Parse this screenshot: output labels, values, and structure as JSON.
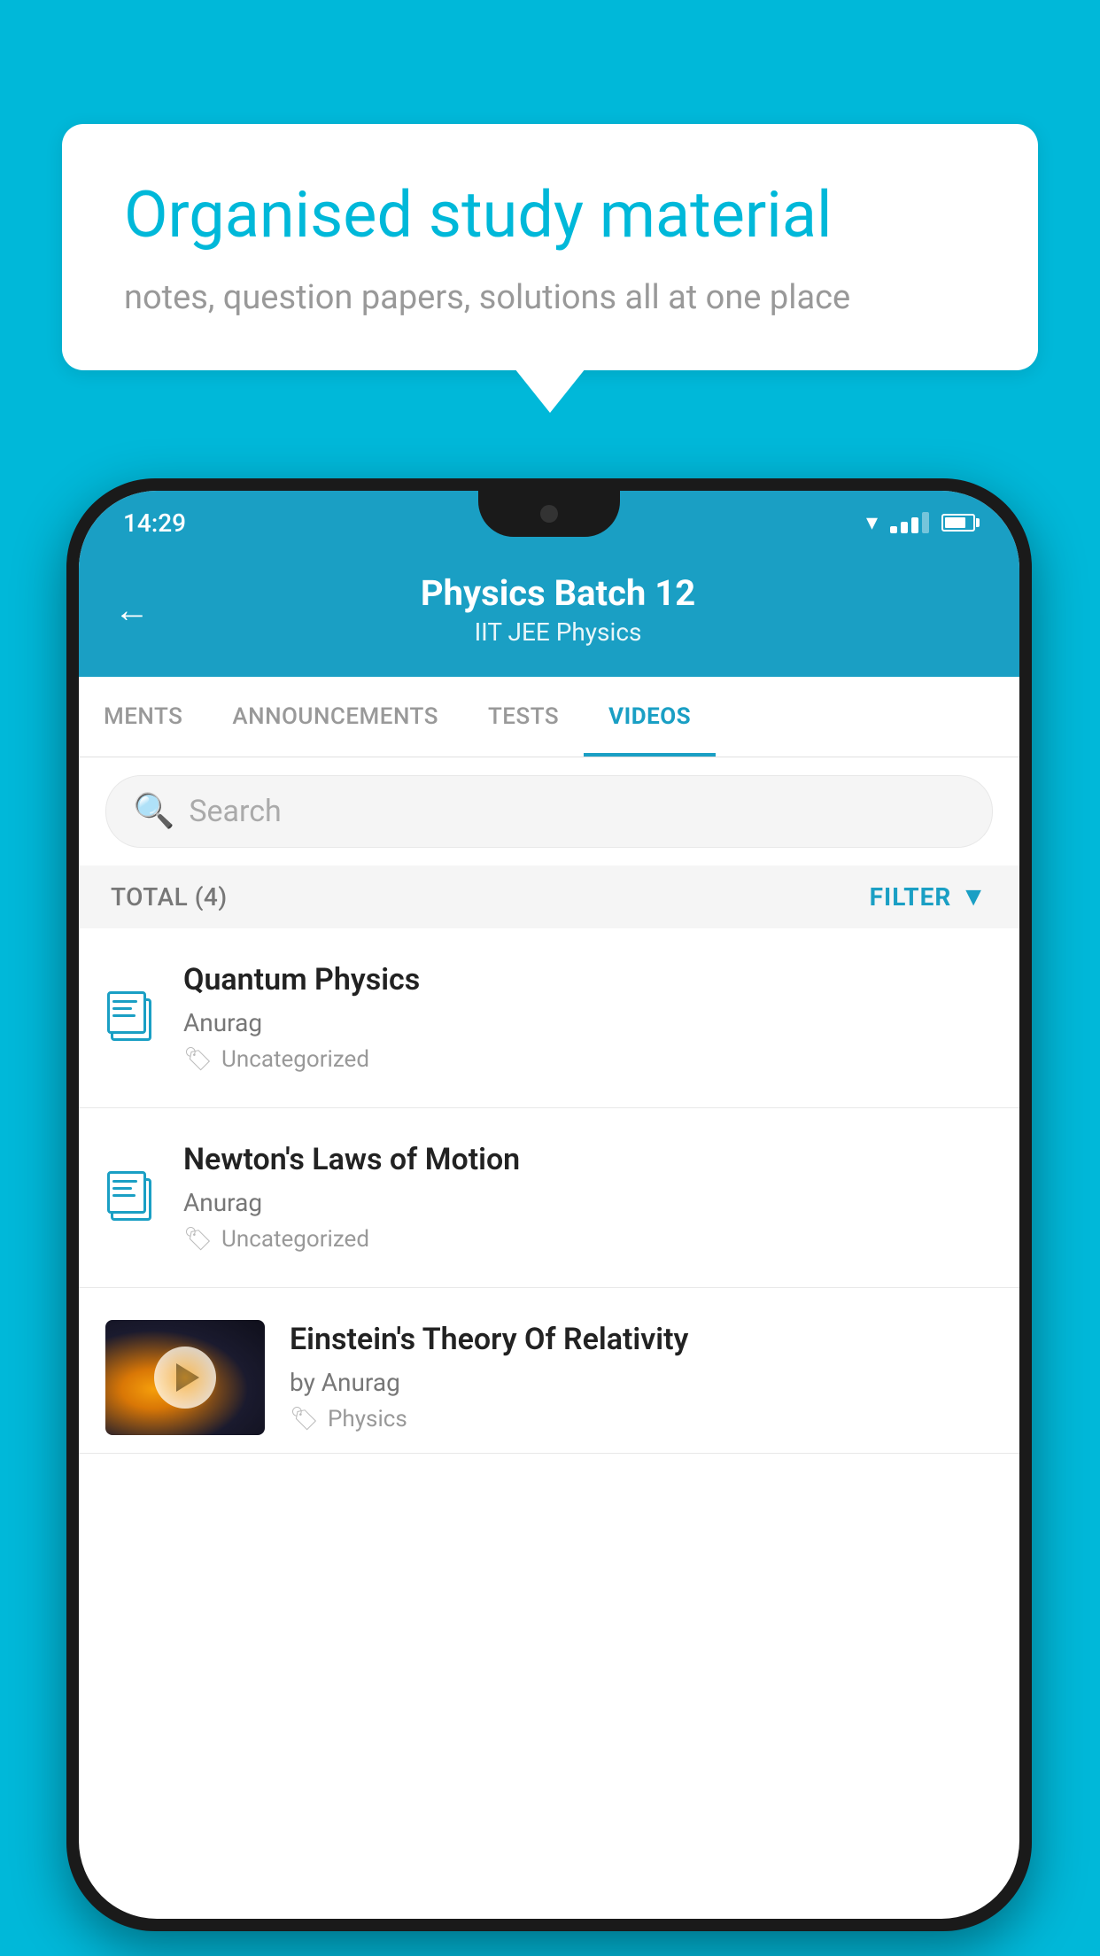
{
  "background_color": "#00B8D9",
  "bubble": {
    "title": "Organised study material",
    "subtitle": "notes, question papers, solutions all at one place"
  },
  "status_bar": {
    "time": "14:29"
  },
  "header": {
    "title": "Physics Batch 12",
    "subtitle": "IIT JEE   Physics"
  },
  "tabs": [
    {
      "label": "MENTS",
      "active": false
    },
    {
      "label": "ANNOUNCEMENTS",
      "active": false
    },
    {
      "label": "TESTS",
      "active": false
    },
    {
      "label": "VIDEOS",
      "active": true
    }
  ],
  "search": {
    "placeholder": "Search"
  },
  "filter": {
    "total_label": "TOTAL (4)",
    "filter_label": "FILTER"
  },
  "videos": [
    {
      "id": 1,
      "title": "Quantum Physics",
      "author": "Anurag",
      "tag": "Uncategorized",
      "type": "folder",
      "has_thumbnail": false
    },
    {
      "id": 2,
      "title": "Newton's Laws of Motion",
      "author": "Anurag",
      "tag": "Uncategorized",
      "type": "folder",
      "has_thumbnail": false
    },
    {
      "id": 3,
      "title": "Einstein's Theory Of Relativity",
      "author": "by Anurag",
      "tag": "Physics",
      "type": "video",
      "has_thumbnail": true
    }
  ]
}
